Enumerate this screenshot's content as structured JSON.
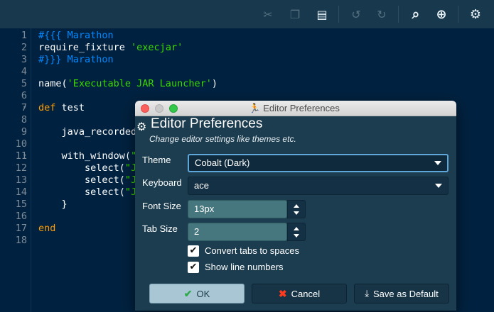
{
  "toolbar": {
    "buttons": [
      {
        "icon": "scissors-icon",
        "glyph": "✂",
        "active": false
      },
      {
        "icon": "copy-icon",
        "glyph": "❐",
        "active": false
      },
      {
        "icon": "paste-icon",
        "glyph": "▤",
        "active": true
      },
      {
        "icon": "undo-icon",
        "glyph": "↺",
        "active": false
      },
      {
        "icon": "redo-icon",
        "glyph": "↻",
        "active": false
      },
      {
        "icon": "search-icon",
        "glyph": "⌕",
        "active": true
      },
      {
        "icon": "zoom-in-icon",
        "glyph": "⊕",
        "active": true
      },
      {
        "icon": "gears-icon",
        "glyph": "⚙",
        "active": true
      }
    ]
  },
  "editor": {
    "lines": [
      {
        "n": "1",
        "fold": "",
        "segments": [
          {
            "t": "#{{{ Marathon",
            "c": "comment"
          }
        ]
      },
      {
        "n": "2",
        "fold": "",
        "segments": [
          {
            "t": "require_fixture ",
            "c": "plain"
          },
          {
            "t": "'execjar'",
            "c": "str"
          }
        ]
      },
      {
        "n": "3",
        "fold": "",
        "segments": [
          {
            "t": "#}}} Marathon",
            "c": "comment"
          }
        ]
      },
      {
        "n": "4",
        "fold": "",
        "segments": []
      },
      {
        "n": "5",
        "fold": "",
        "segments": [
          {
            "t": "name(",
            "c": "plain"
          },
          {
            "t": "'Executable JAR Launcher'",
            "c": "str"
          },
          {
            "t": ")",
            "c": "plain"
          }
        ]
      },
      {
        "n": "6",
        "fold": "",
        "segments": []
      },
      {
        "n": "7",
        "fold": "▾",
        "segments": [
          {
            "t": "def ",
            "c": "kw"
          },
          {
            "t": "test",
            "c": "plain"
          }
        ]
      },
      {
        "n": "8",
        "fold": "",
        "segments": []
      },
      {
        "n": "9",
        "fold": "",
        "segments": [
          {
            "t": "    java_recorded_",
            "c": "plain"
          }
        ]
      },
      {
        "n": "10",
        "fold": "",
        "segments": []
      },
      {
        "n": "11",
        "fold": "▾",
        "segments": [
          {
            "t": "    with_window(",
            "c": "plain"
          },
          {
            "t": "\"S",
            "c": "str"
          }
        ]
      },
      {
        "n": "12",
        "fold": "",
        "segments": [
          {
            "t": "        select(",
            "c": "plain"
          },
          {
            "t": "\"JS",
            "c": "str"
          }
        ]
      },
      {
        "n": "13",
        "fold": "",
        "segments": [
          {
            "t": "        select(",
            "c": "plain"
          },
          {
            "t": "\"JS",
            "c": "str"
          }
        ]
      },
      {
        "n": "14",
        "fold": "",
        "segments": [
          {
            "t": "        select(",
            "c": "plain"
          },
          {
            "t": "\"JS",
            "c": "str"
          }
        ]
      },
      {
        "n": "15",
        "fold": "",
        "segments": [
          {
            "t": "    }",
            "c": "plain"
          }
        ]
      },
      {
        "n": "16",
        "fold": "",
        "segments": []
      },
      {
        "n": "17",
        "fold": "",
        "segments": [
          {
            "t": "end",
            "c": "kw"
          }
        ]
      },
      {
        "n": "18",
        "fold": "",
        "segments": []
      }
    ]
  },
  "dialog": {
    "window_title": "Editor Preferences",
    "title": "Editor Preferences",
    "subtitle": "Change editor settings like themes etc.",
    "theme_label": "Theme",
    "theme_value": "Cobalt (Dark)",
    "keyboard_label": "Keyboard",
    "keyboard_value": "ace",
    "font_size_label": "Font Size",
    "font_size_value": "13px",
    "tab_size_label": "Tab Size",
    "tab_size_value": "2",
    "convert_tabs_label": "Convert tabs to spaces",
    "convert_tabs_checked": true,
    "show_line_numbers_label": "Show line numbers",
    "show_line_numbers_checked": true,
    "ok_label": "OK",
    "cancel_label": "Cancel",
    "save_default_label": "Save as Default"
  },
  "colors": {
    "editor_bg": "#002240",
    "comment": "#0088ff",
    "string": "#3ad900",
    "keyword": "#ff9d00",
    "dialog_bg": "#1c3d4f"
  }
}
